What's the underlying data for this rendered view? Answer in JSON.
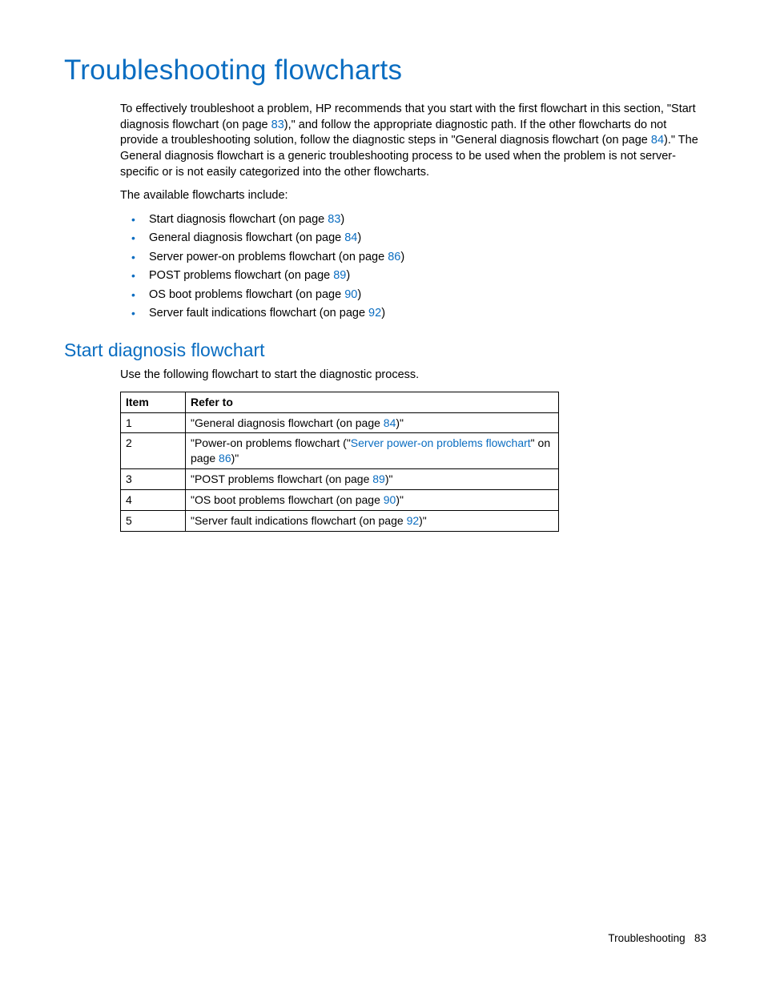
{
  "heading": "Troubleshooting flowcharts",
  "intro": {
    "p1a": "To effectively troubleshoot a problem, HP recommends that you start with the first flowchart in this section, \"Start diagnosis flowchart (on page ",
    "p1a_link": "83",
    "p1b": "),\" and follow the appropriate diagnostic path. If the other flowcharts do not provide a troubleshooting solution, follow the diagnostic steps in \"General diagnosis flowchart (on page ",
    "p1b_link": "84",
    "p1c": ").\" The General diagnosis flowchart is a generic troubleshooting process to be used when the problem is not server-specific or is not easily categorized into the other flowcharts.",
    "p2": "The available flowcharts include:"
  },
  "bullets": [
    {
      "pre": "Start diagnosis flowchart (on page ",
      "pg": "83",
      "post": ")"
    },
    {
      "pre": "General diagnosis flowchart (on page ",
      "pg": "84",
      "post": ")"
    },
    {
      "pre": "Server power-on problems flowchart (on page ",
      "pg": "86",
      "post": ")"
    },
    {
      "pre": "POST problems flowchart (on page ",
      "pg": "89",
      "post": ")"
    },
    {
      "pre": "OS boot problems flowchart (on page ",
      "pg": "90",
      "post": ")"
    },
    {
      "pre": "Server fault indications flowchart (on page ",
      "pg": "92",
      "post": ")"
    }
  ],
  "subheading": "Start diagnosis flowchart",
  "sub_intro": "Use the following flowchart to start the diagnostic process.",
  "table": {
    "headers": {
      "item": "Item",
      "refer": "Refer to"
    },
    "rows": [
      {
        "n": "1",
        "a": "\"General diagnosis flowchart (on page ",
        "link": "84",
        "b": ")\""
      },
      {
        "n": "2",
        "a": "\"Power-on problems flowchart (\"",
        "link": "Server power-on problems flowchart",
        "b": "\" on page ",
        "link2": "86",
        "c": ")\""
      },
      {
        "n": "3",
        "a": "\"POST problems flowchart (on page ",
        "link": "89",
        "b": ")\""
      },
      {
        "n": "4",
        "a": "\"OS boot problems flowchart (on page ",
        "link": "90",
        "b": ")\""
      },
      {
        "n": "5",
        "a": "\"Server fault indications flowchart (on page ",
        "link": "92",
        "b": ")\""
      }
    ]
  },
  "footer": {
    "section": "Troubleshooting",
    "page": "83"
  }
}
